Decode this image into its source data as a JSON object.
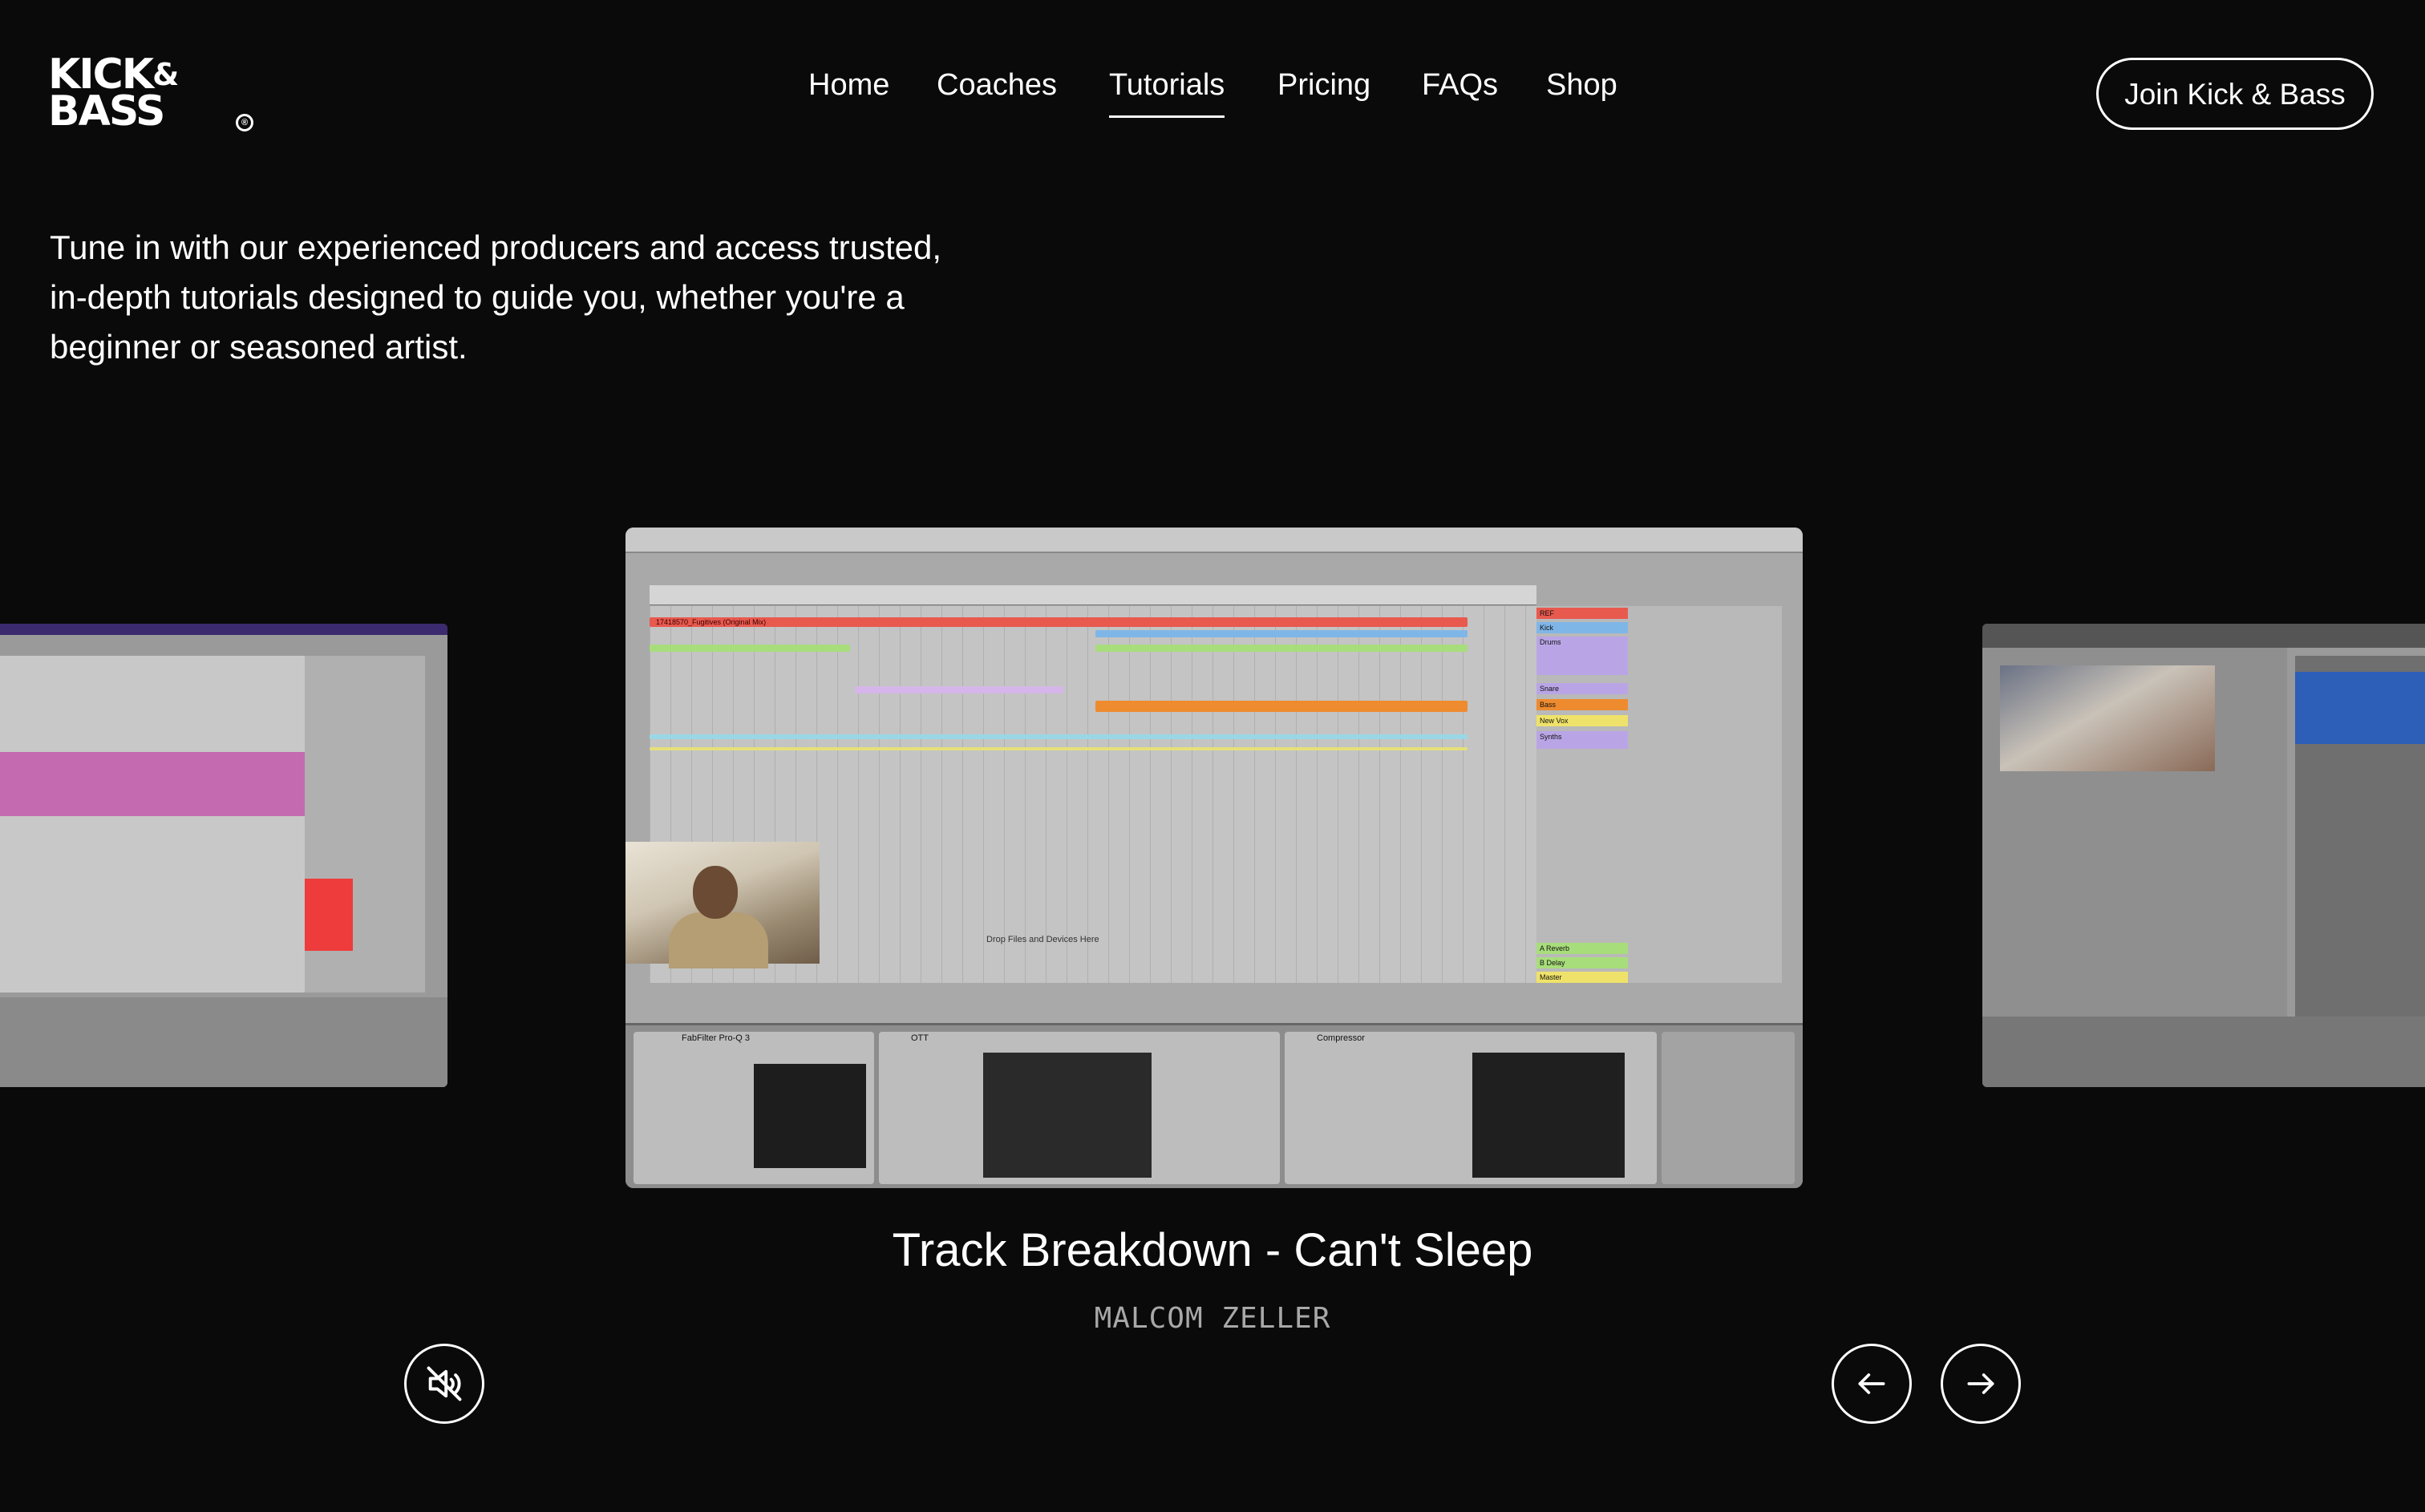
{
  "brand": {
    "line1": "KICK",
    "amp": "&",
    "line2": "BASS",
    "reg_mark": "®"
  },
  "nav": {
    "items": [
      {
        "label": "Home"
      },
      {
        "label": "Coaches"
      },
      {
        "label": "Tutorials",
        "active": true
      },
      {
        "label": "Pricing"
      },
      {
        "label": "FAQs"
      },
      {
        "label": "Shop"
      }
    ],
    "cta_label": "Join Kick & Bass"
  },
  "intro": {
    "line1": "Tune in with our experienced producers and access trusted,",
    "line2": "in-depth tutorials designed to guide you, whether you're a",
    "line3": "beginner or seasoned artist."
  },
  "carousel": {
    "current": {
      "title": "Track Breakdown - Can't Sleep",
      "author": "MALCOM ZELLER",
      "screen": {
        "clip_name": "17418570_Fugitives (Original Mix)",
        "drop_label": "Drop Files and Devices Here",
        "tracks": [
          "REF",
          "Kick",
          "Drums",
          "Snare",
          "Bass",
          "New Vox",
          "Synths",
          "A Reverb",
          "B Delay",
          "Master"
        ],
        "devices": [
          "FabFilter Pro-Q 3",
          "OTT",
          "Compressor"
        ]
      }
    },
    "controls": {
      "mute_icon": "speaker-muted-icon",
      "prev_icon": "arrow-left-icon",
      "next_icon": "arrow-right-icon"
    }
  },
  "colors": {
    "background": "#0a0a0a",
    "text": "#ffffff",
    "muted_text": "#a8a8a8",
    "clip_red": "#e8594e",
    "clip_orange": "#ee8b2f",
    "track_purple": "#b9a5e6",
    "track_yellow": "#efe26a"
  }
}
